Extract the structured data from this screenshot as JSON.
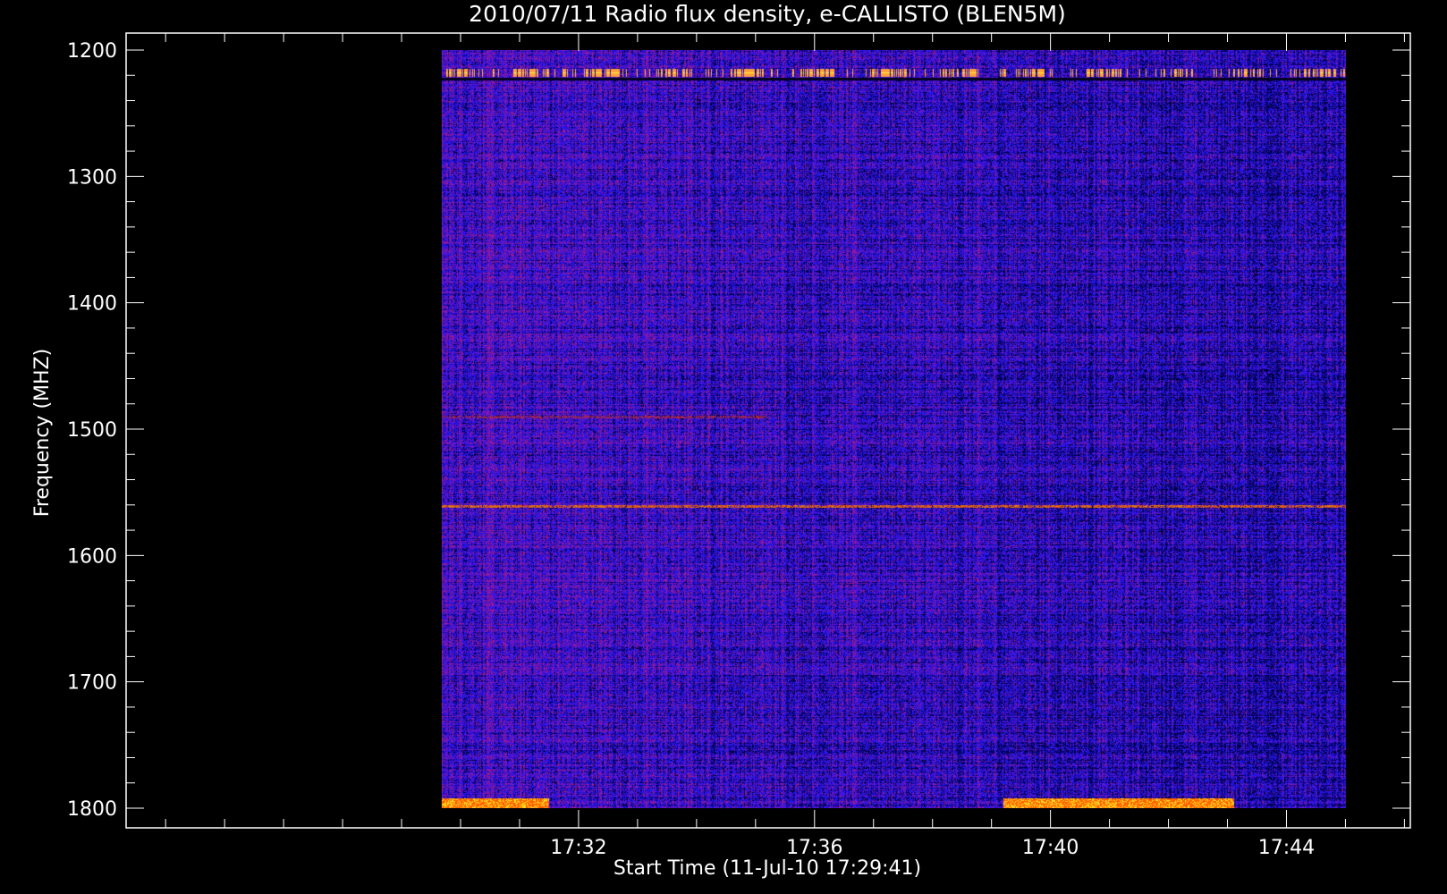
{
  "chart_data": {
    "type": "heatmap",
    "title": "2010/07/11  Radio flux density, e-CALLISTO (BLEN5M)",
    "xlabel": "Start Time (11-Jul-10 17:29:41)",
    "ylabel": "Frequency (MHZ)",
    "x_ticks": [
      "17:32",
      "17:36",
      "17:40",
      "17:44"
    ],
    "x_tick_minutes": [
      32,
      36,
      40,
      44
    ],
    "x_range_minutes": [
      24.33,
      46.1
    ],
    "data_time_range_minutes": [
      29.68,
      45.0
    ],
    "y_ticks": [
      1200,
      1300,
      1400,
      1500,
      1600,
      1700,
      1800
    ],
    "ylim": [
      1200,
      1800
    ],
    "y_inverted": true,
    "grid": false,
    "colormap": [
      "#000000",
      "#1a1aa0",
      "#2323ff",
      "#8a1a5a",
      "#d81f10",
      "#ff7f00",
      "#ffff40"
    ],
    "features": [
      {
        "kind": "intermittent bright band",
        "freq_mhz": 1218,
        "time_start_min": 29.68,
        "time_end_min": 45.0
      },
      {
        "kind": "faint red band",
        "freq_mhz": 1490,
        "time_start_min": 29.68,
        "time_end_min": 35.2
      },
      {
        "kind": "persistent red band",
        "freq_mhz": 1561,
        "time_start_min": 29.68,
        "time_end_min": 45.0
      },
      {
        "kind": "bright emission at edge",
        "freq_mhz": 1797,
        "time_start_min": 29.68,
        "time_end_min": 31.5
      },
      {
        "kind": "bright emission at edge",
        "freq_mhz": 1797,
        "time_start_min": 39.2,
        "time_end_min": 43.1
      }
    ]
  }
}
